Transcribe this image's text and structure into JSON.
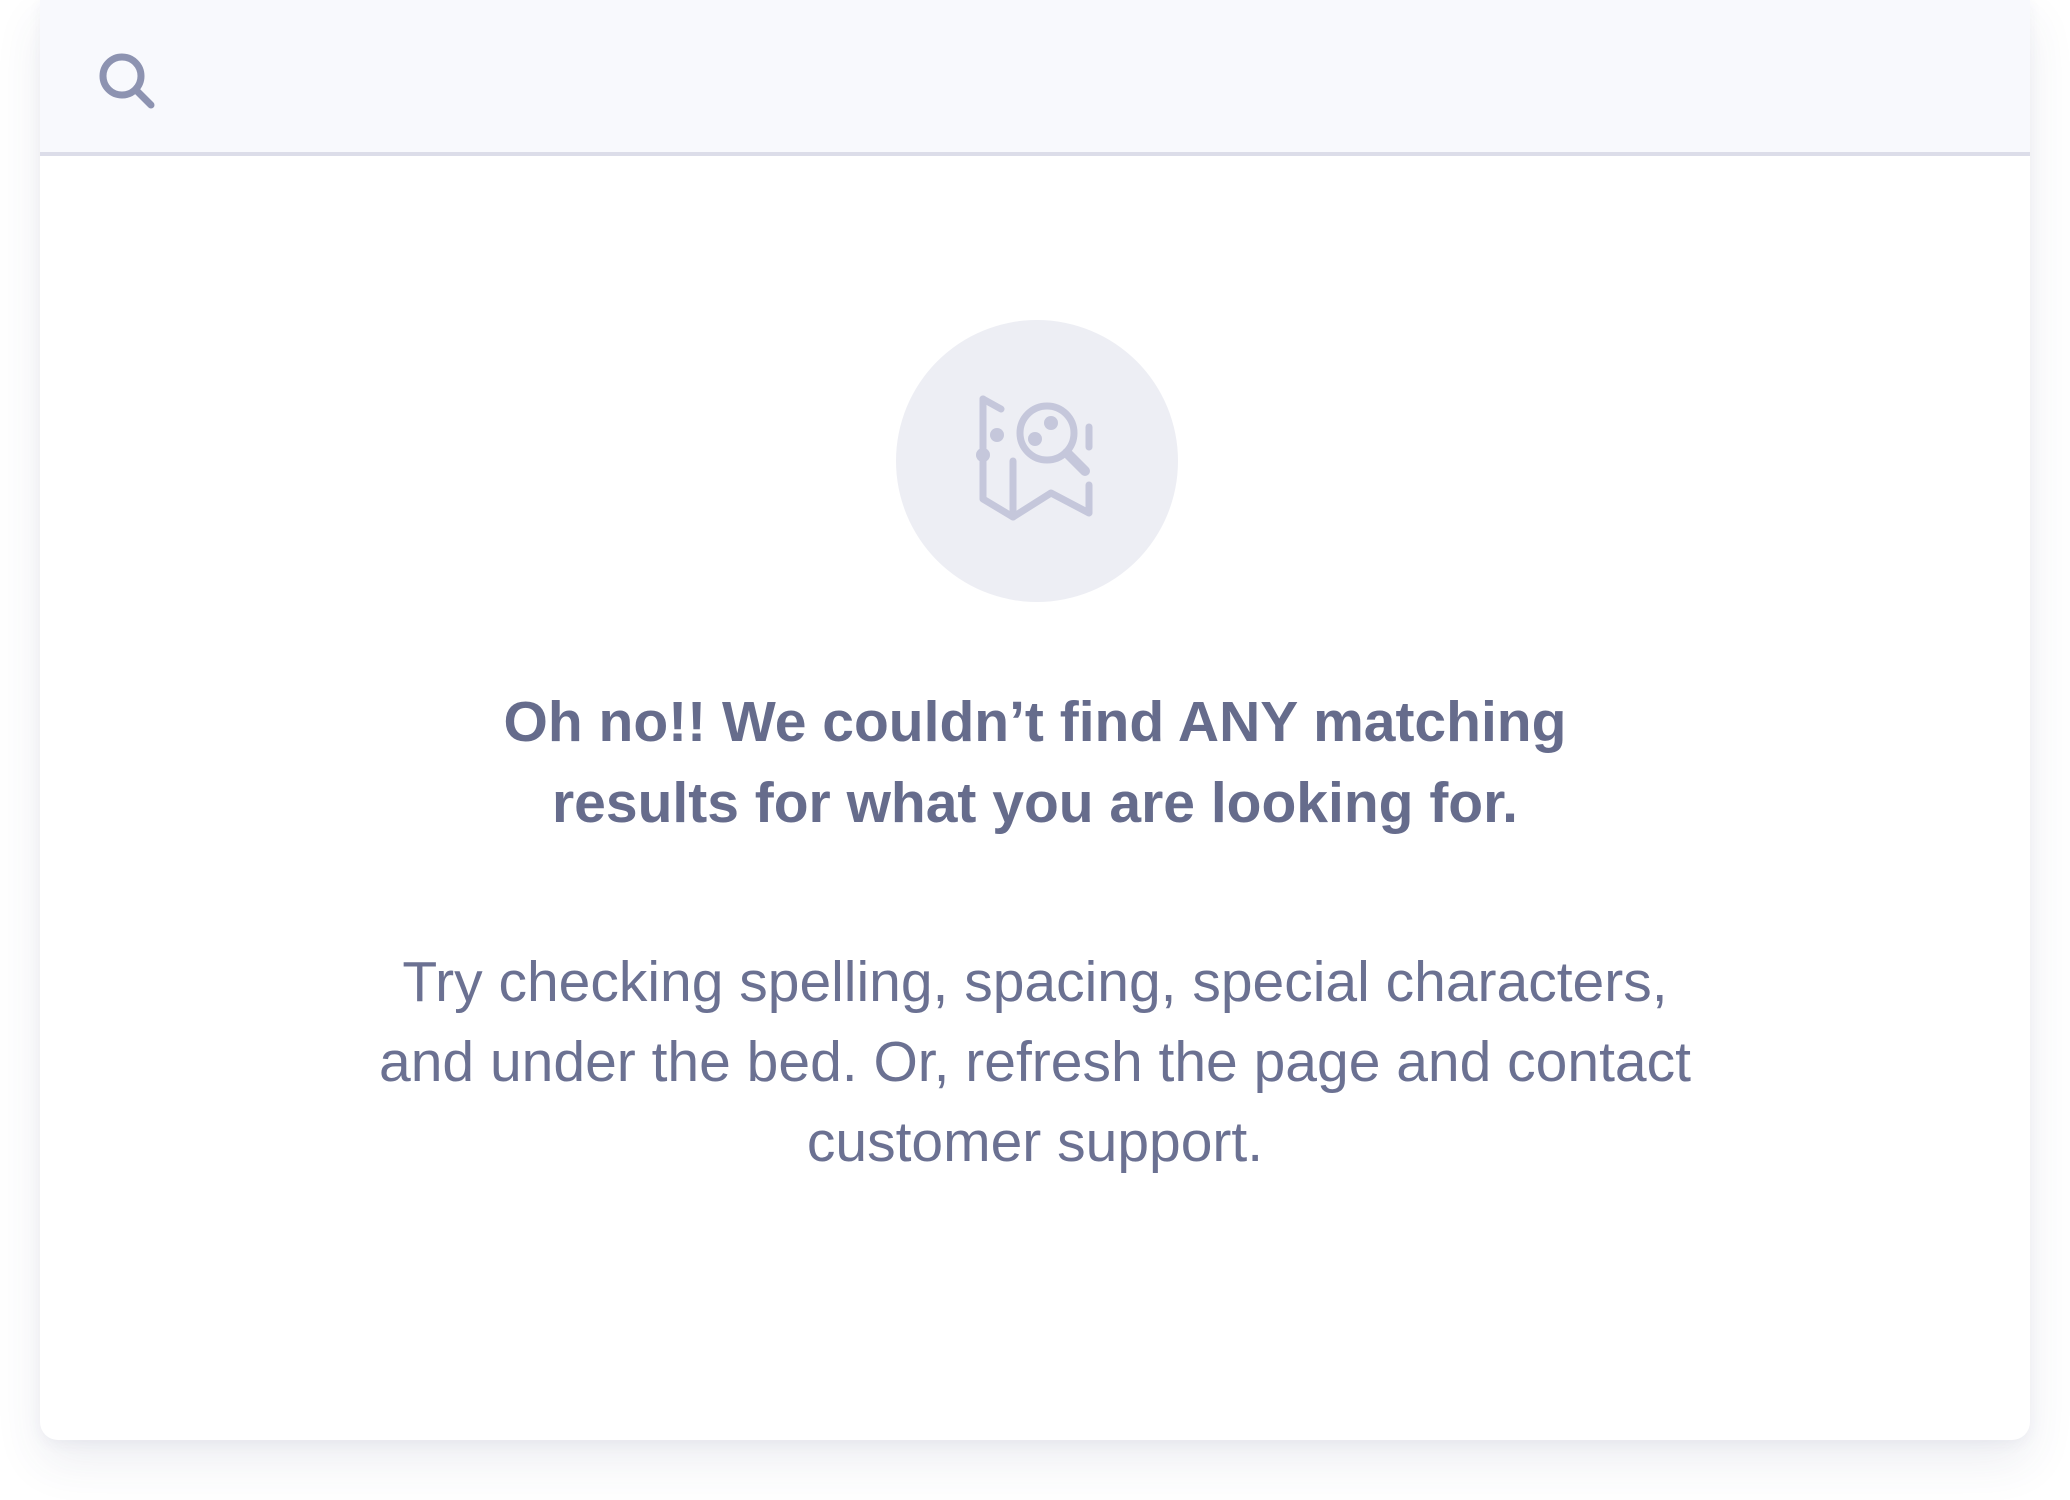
{
  "search": {
    "placeholder": "",
    "value": "",
    "icon": "search-icon"
  },
  "empty_state": {
    "icon": "map-search-icon",
    "headline_lines": [
      "Oh no!! We couldn’t find ANY matching",
      "results for what you are looking for."
    ],
    "message_lines": [
      "Try checking spelling, spacing, special characters,",
      "and under the bed. Or, refresh the page and contact",
      "customer support."
    ]
  },
  "colors": {
    "search_bar_background": "#f8f9fd",
    "divider": "#dcdde9",
    "icon": "#8d93b1",
    "illustration_circle": "#edeef4",
    "illustration_stroke": "#c5c7db",
    "text": "#666c8c"
  }
}
